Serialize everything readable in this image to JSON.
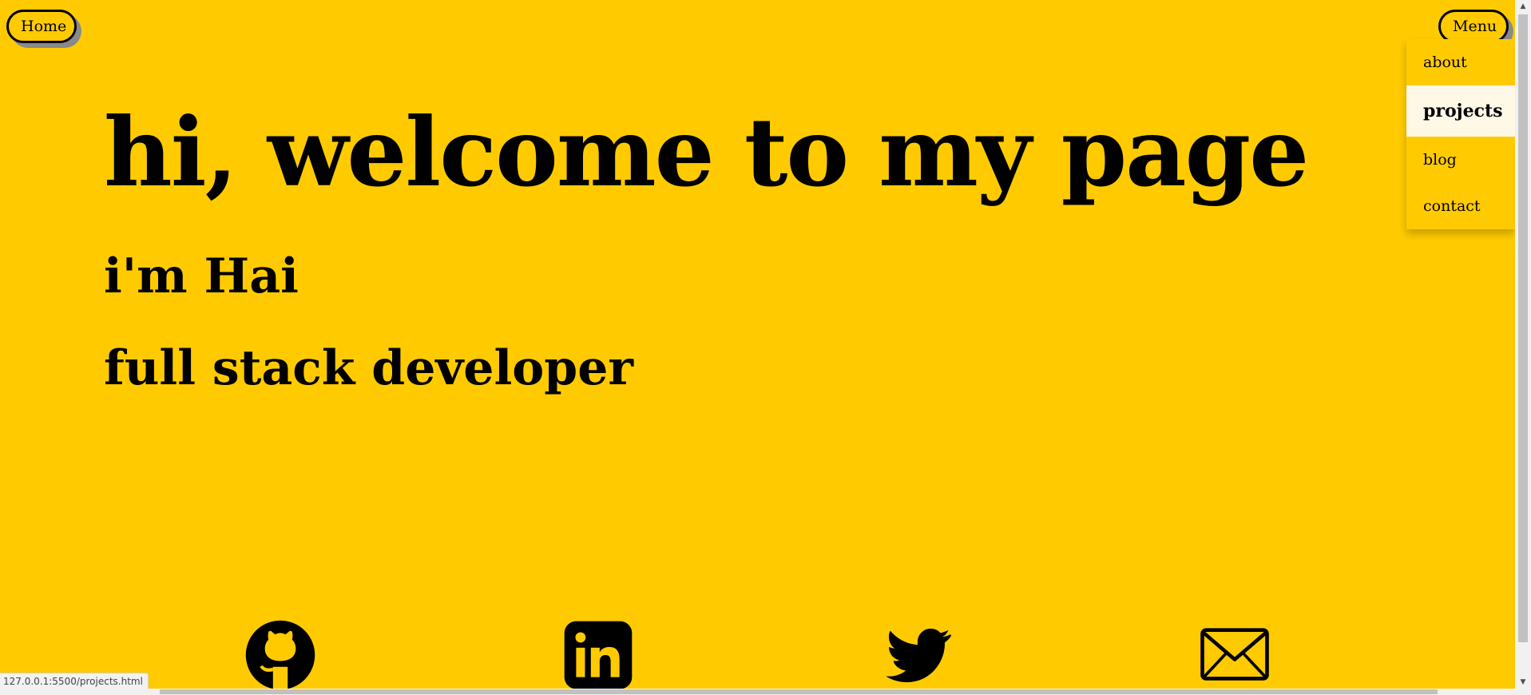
{
  "nav": {
    "home_label": "Home",
    "menu_label": "Menu"
  },
  "menu": {
    "items": [
      {
        "label": "about",
        "active": false
      },
      {
        "label": "projects",
        "active": true
      },
      {
        "label": "blog",
        "active": false
      },
      {
        "label": "contact",
        "active": false
      }
    ]
  },
  "hero": {
    "title": "hi, welcome to my page",
    "name": "i'm Hai",
    "role": "full stack developer"
  },
  "social": {
    "icons": [
      "github-icon",
      "linkedin-icon",
      "twitter-icon",
      "email-icon"
    ]
  },
  "status": {
    "url": "127.0.0.1:5500/projects.html"
  },
  "colors": {
    "background": "#ffcb00",
    "text": "#000000",
    "menu_active_bg": "#fff8e6",
    "button_shadow": "#8a8a8a"
  }
}
